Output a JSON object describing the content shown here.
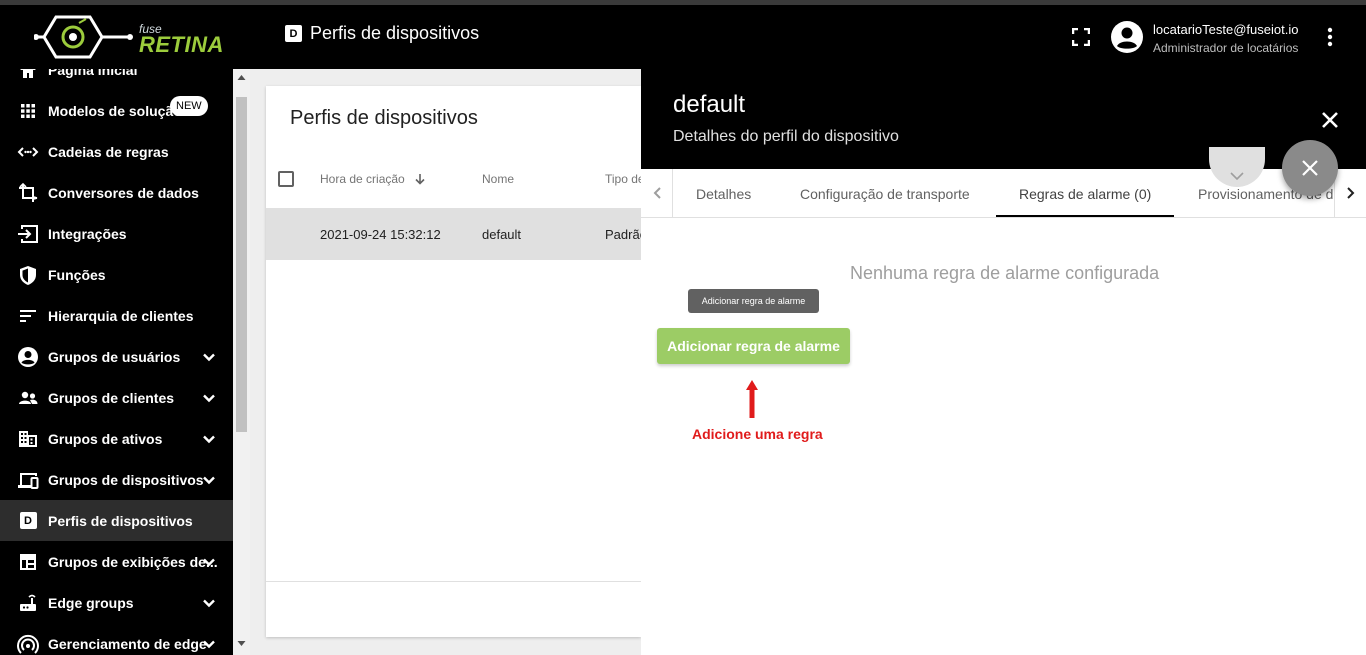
{
  "brand": {
    "small": "fuse",
    "large": "RETINA"
  },
  "header": {
    "badge": "D",
    "title": "Perfis de dispositivos",
    "user_email": "locatarioTeste@fuseiot.io",
    "user_role": "Administrador de locatários"
  },
  "sidebar": {
    "items": [
      {
        "label": "Página inicial",
        "icon": "home-icon"
      },
      {
        "label": "Modelos de solução",
        "icon": "grid-icon",
        "badge": "NEW"
      },
      {
        "label": "Cadeias de regras",
        "icon": "code-arrows-icon"
      },
      {
        "label": "Conversores de dados",
        "icon": "transform-icon"
      },
      {
        "label": "Integrações",
        "icon": "input-icon"
      },
      {
        "label": "Funções",
        "icon": "shield-icon"
      },
      {
        "label": "Hierarquia de clientes",
        "icon": "sort-lines-icon"
      },
      {
        "label": "Grupos de usuários",
        "icon": "account-circle-icon"
      },
      {
        "label": "Grupos de clientes",
        "icon": "supervisor-icon"
      },
      {
        "label": "Grupos de ativos",
        "icon": "domain-icon"
      },
      {
        "label": "Grupos de dispositivos",
        "icon": "devices-icon"
      },
      {
        "label": "Perfis de dispositivos",
        "icon": "device-profile-icon"
      },
      {
        "label": "Grupos de exibições de...",
        "icon": "dashboard-icon"
      },
      {
        "label": "Edge groups",
        "icon": "router-icon"
      },
      {
        "label": "Gerenciamento de edge",
        "icon": "wifi-tethering-icon"
      }
    ]
  },
  "list": {
    "title": "Perfis de dispositivos",
    "columns": [
      "Hora de criação",
      "Nome",
      "Tipo de"
    ],
    "rows": [
      {
        "created": "2021-09-24 15:32:12",
        "name": "default",
        "type": "Padrão"
      }
    ]
  },
  "details": {
    "title": "default",
    "subtitle": "Detalhes do perfil do dispositivo",
    "tabs": [
      "Detalhes",
      "Configuração de transporte",
      "Regras de alarme (0)",
      "Provisionamento de d"
    ],
    "active_tab": "Regras de alarme (0)",
    "empty_message": "Nenhuma regra de alarme configurada",
    "tooltip": "Adicionar regra de alarme",
    "add_button": "Adicionar regra de alarme",
    "annotation": "Adicione uma regra"
  },
  "colors": {
    "accent_green": "#9ccc65",
    "annotation_red": "#e01b1b",
    "header_bg": "#000000"
  }
}
